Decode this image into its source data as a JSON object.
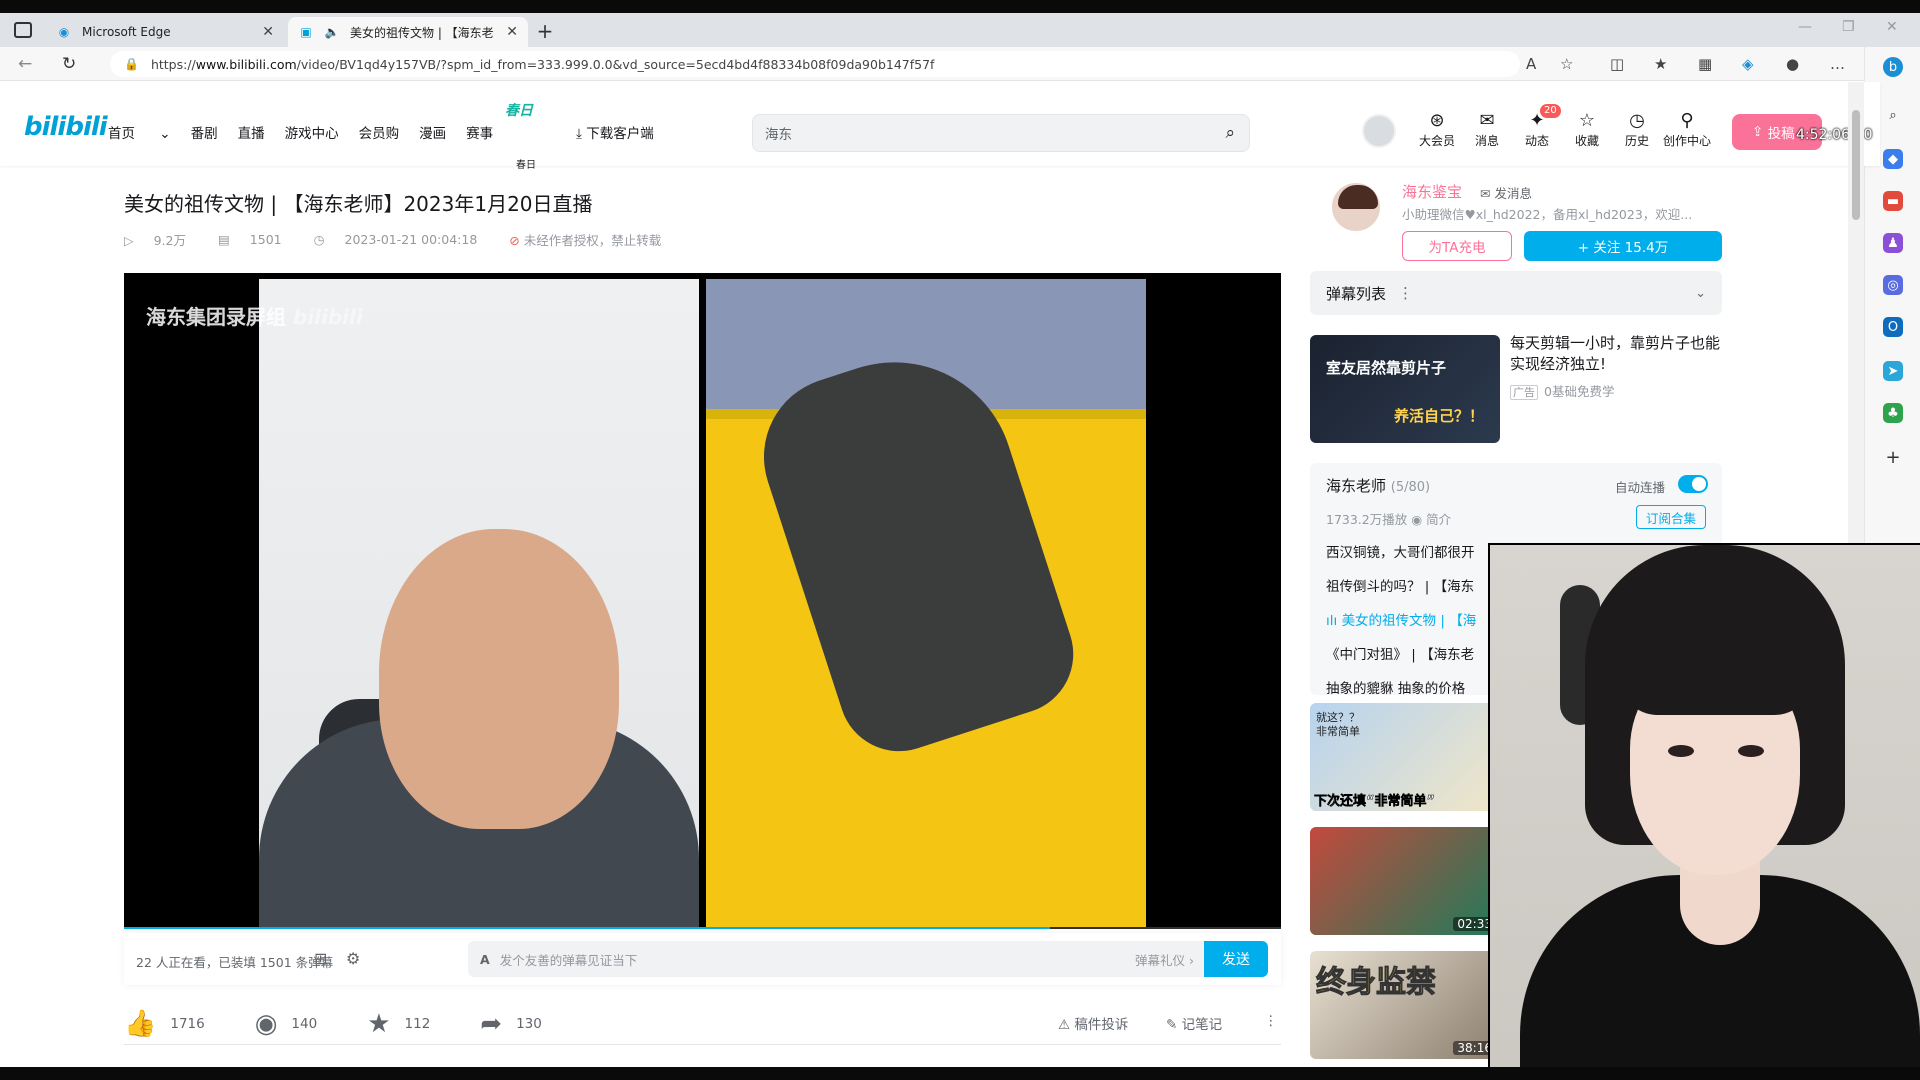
{
  "browser": {
    "tabs": [
      {
        "title": "Microsoft Edge"
      },
      {
        "title": "美女的祖传文物 | 【海东老"
      }
    ],
    "url_prefix": "https://",
    "url_host": "www.bilibili.com",
    "url_path": "/video/BV1qd4y157VB/?spm_id_from=333.999.0.0&vd_source=5ecd4bd4f88334b08f09da90b147f57f"
  },
  "header": {
    "logo": "bilibili",
    "nav": [
      "首页",
      "番剧",
      "直播",
      "游戏中心",
      "会员购",
      "漫画",
      "赛事"
    ],
    "spring": "春日",
    "spring_sub": "春日",
    "download": "下载客户端",
    "search_value": "海东",
    "icons": [
      {
        "label": "大会员",
        "icon": "vip-icon"
      },
      {
        "label": "消息",
        "icon": "message-icon"
      },
      {
        "label": "动态",
        "icon": "dynamic-icon",
        "badge": "20"
      },
      {
        "label": "收藏",
        "icon": "favorite-icon"
      },
      {
        "label": "历史",
        "icon": "history-icon"
      },
      {
        "label": "创作中心",
        "icon": "creator-icon"
      }
    ],
    "upload": "投稿",
    "clock": "4:52:06:00"
  },
  "video": {
    "title": "美女的祖传文物 | 【海东老师】2023年1月20日直播",
    "views": "9.2万",
    "danmaku_count": "1501",
    "date": "2023-01-21 00:04:18",
    "copyright": "未经作者授权，禁止转载",
    "watermark": "海东集团录屏组",
    "watermark_logo": "bilibili",
    "progress": 0.8
  },
  "danmaku_bar": {
    "info": "22 人正在看，已装填 1501 条弹幕",
    "placeholder": "发个友善的弹幕见证当下",
    "gift": "弹幕礼仪 ›",
    "send": "发送"
  },
  "actions": {
    "like": "1716",
    "coin": "140",
    "fav": "112",
    "share": "130",
    "report": "稿件投诉",
    "notes": "记笔记"
  },
  "uploader": {
    "name": "海东鉴宝",
    "message": "发消息",
    "desc": "小助理微信♥xl_hd2022，备用xl_hd2023，欢迎...",
    "charge": "为TA充电",
    "follow": "+ 关注 15.4万"
  },
  "danmaku_list": {
    "label": "弹幕列表"
  },
  "ad": {
    "thumb_text1": "室友居然靠剪片子",
    "thumb_text2": "养活自己？！",
    "title": "每天剪辑一小时，靠剪片子也能实现经济独立!",
    "tag": "广告",
    "source": "0基础免费学"
  },
  "collection": {
    "title": "海东老师",
    "count": "(5/80)",
    "autoplay": "自动连播",
    "stats": "1733.2万播放",
    "intro": "简介",
    "subscribe": "订阅合集",
    "items": [
      "西汉铜镜，大哥们都很开",
      "祖传倒斗的吗？ | 【海东",
      "美女的祖传文物 | 【海",
      "《中门对狙》 | 【海东老",
      "抽象的貔貅 抽象的价格"
    ]
  },
  "related": [
    {
      "overlay": "就这？？非常简单",
      "overlay2": "下次还填“非常简单”",
      "duration": ""
    },
    {
      "overlay": "",
      "overlay2": "",
      "duration": "02:33"
    },
    {
      "overlay": "终身监禁",
      "overlay2": "",
      "duration": "38:16"
    }
  ],
  "colors": {
    "accent": "#00aeec",
    "pink": "#fb7299"
  }
}
